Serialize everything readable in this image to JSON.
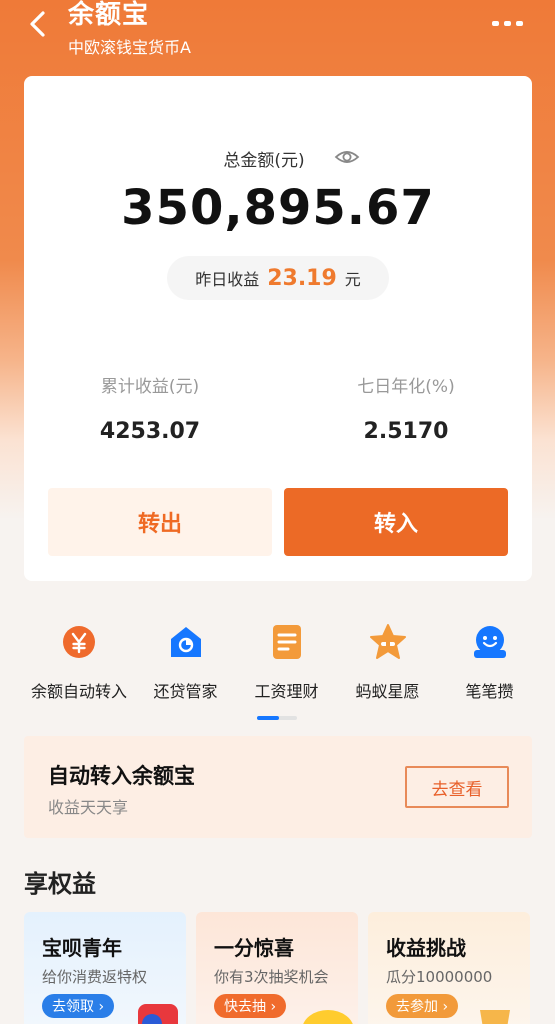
{
  "header": {
    "title": "余额宝",
    "subtitle": "中欧滚钱宝货币A"
  },
  "summary": {
    "total_label": "总金额(元)",
    "total_amount": "350,895.67",
    "yesterday_label": "昨日收益",
    "yesterday_value": "23.19",
    "yesterday_unit": "元",
    "cumulative_label": "累计收益(元)",
    "cumulative_value": "4253.07",
    "seven_day_label": "七日年化(%)",
    "seven_day_value": "2.5170",
    "transfer_out": "转出",
    "transfer_in": "转入"
  },
  "shortcuts": [
    {
      "label": "余额自动转入",
      "icon": "yen-coin-icon"
    },
    {
      "label": "还贷管家",
      "icon": "house-icon"
    },
    {
      "label": "工资理财",
      "icon": "document-icon"
    },
    {
      "label": "蚂蚁星愿",
      "icon": "star-icon"
    },
    {
      "label": "笔笔攒",
      "icon": "smiley-icon"
    }
  ],
  "promo": {
    "title": "自动转入余额宝",
    "subtitle": "收益天天享",
    "button": "去查看"
  },
  "benefits_title": "享权益",
  "benefits": [
    {
      "title": "宝呗青年",
      "subtitle": "给你消费返特权",
      "button": "去领取 ›"
    },
    {
      "title": "一分惊喜",
      "subtitle": "你有3次抽奖机会",
      "button": "快去抽 ›"
    },
    {
      "title": "收益挑战",
      "subtitle": "瓜分10000000",
      "button": "去参加 ›"
    }
  ],
  "colors": {
    "brand_orange": "#ec6a26",
    "pager_active": "#1677ff"
  }
}
